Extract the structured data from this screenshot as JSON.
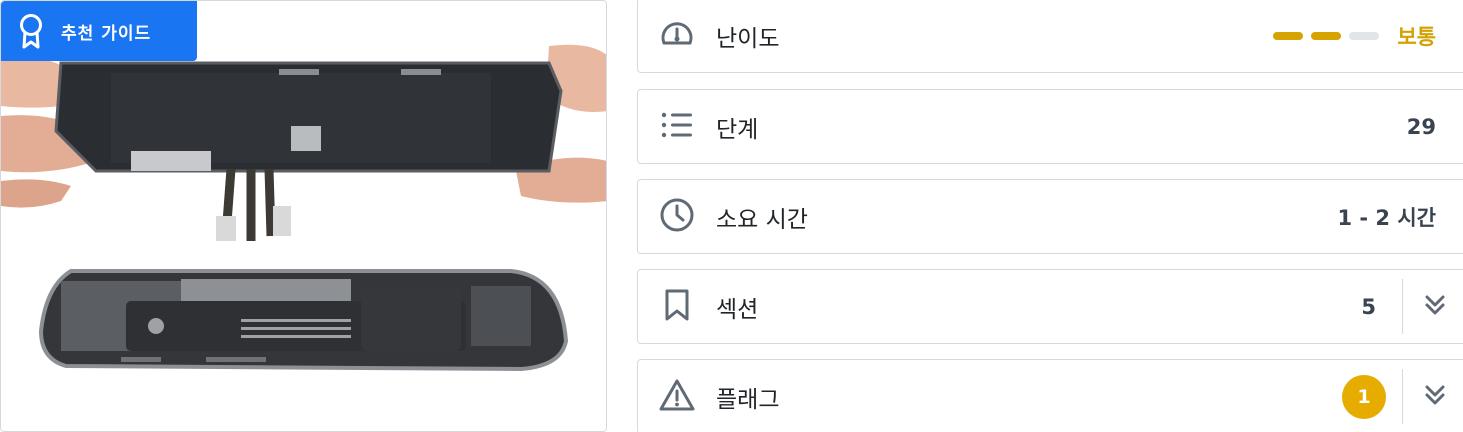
{
  "badge": {
    "label": "추천 가이드",
    "icon": "award-ribbon-icon",
    "color": "#1975f2"
  },
  "photo": {
    "alt_icon": "phone-teardown-image"
  },
  "rows": {
    "difficulty": {
      "label": "난이도",
      "value": "보통",
      "icon": "gauge-icon",
      "level": 2,
      "level_max": 3,
      "accent": "#d6a400"
    },
    "steps": {
      "label": "단계",
      "value": "29",
      "icon": "list-icon"
    },
    "time": {
      "label": "소요 시간",
      "value": "1 - 2 시간",
      "icon": "clock-icon"
    },
    "sections": {
      "label": "섹션",
      "value": "5",
      "icon": "bookmark-icon",
      "toggle_icon": "double-chevron-down-icon"
    },
    "flags": {
      "label": "플래그",
      "value": "1",
      "icon": "warning-triangle-icon",
      "toggle_icon": "double-chevron-down-icon",
      "badge_color": "#e6ac00"
    }
  }
}
